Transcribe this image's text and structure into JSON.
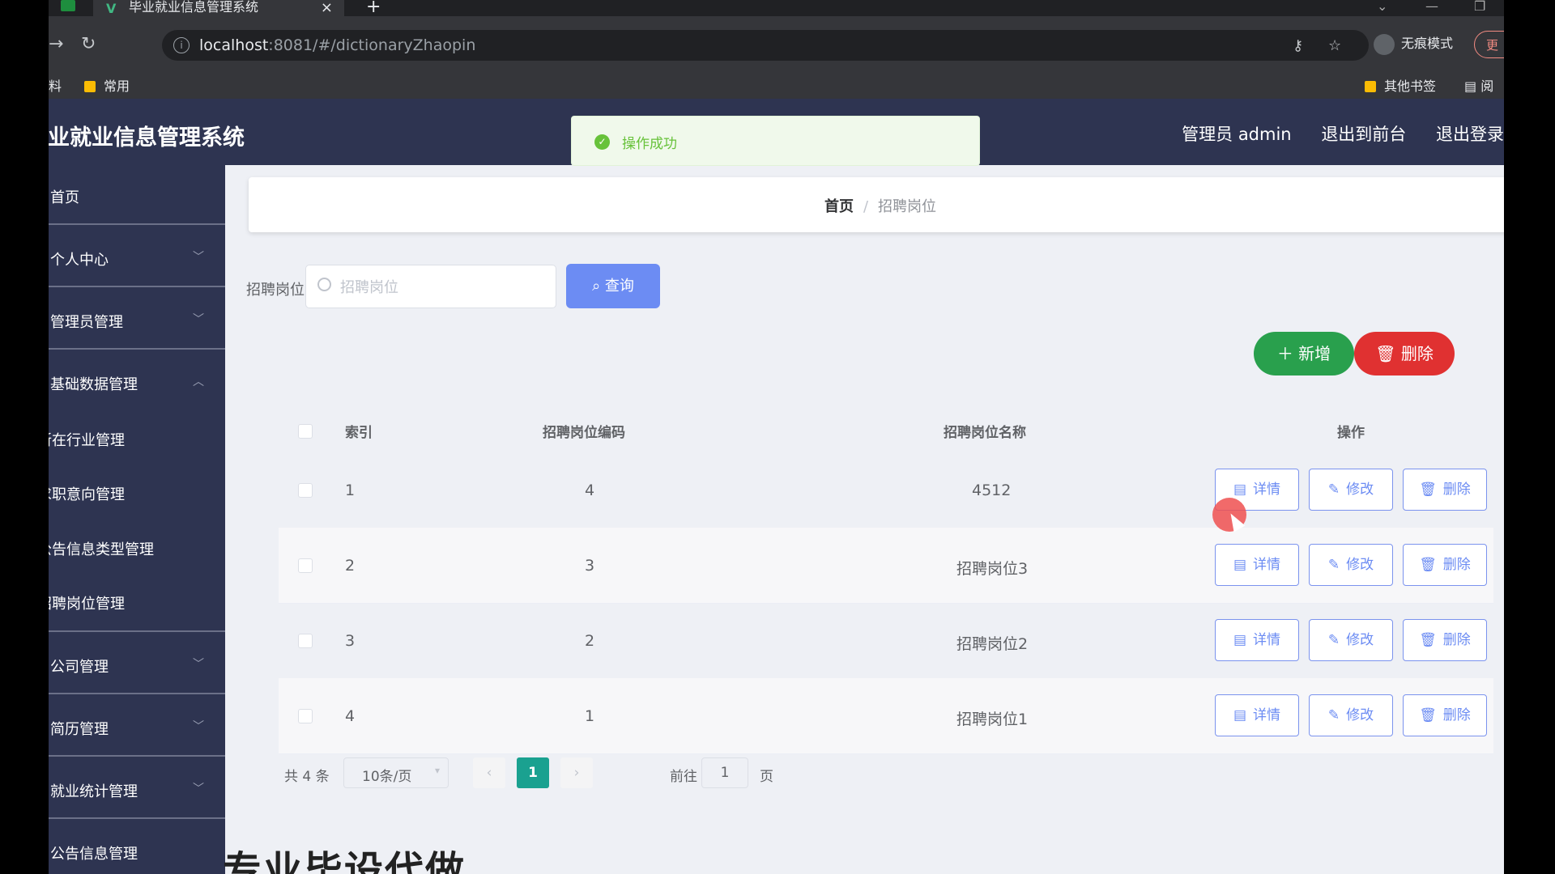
{
  "browser": {
    "tab_title": "毕业就业信息管理系统",
    "url_host": "localhost",
    "url_path": ":8081/#/dictionaryZhaopin",
    "profile_label": "无痕模式",
    "update_label": "更",
    "bookmarks": {
      "left_partial": "料",
      "common": "常用",
      "other": "其他书签",
      "reader": "阅"
    }
  },
  "header": {
    "title": "毕业就业信息管理系统",
    "admin": "管理员 admin",
    "to_front": "退出到前台",
    "logout": "退出登录"
  },
  "toast": {
    "message": "操作成功"
  },
  "sidebar": {
    "items": [
      {
        "label": "首页"
      },
      {
        "label": "个人中心"
      },
      {
        "label": "管理员管理"
      },
      {
        "label": "基础数据管理"
      }
    ],
    "sub_items": [
      {
        "label": "所在行业管理"
      },
      {
        "label": "求职意向管理"
      },
      {
        "label": "公告信息类型管理"
      },
      {
        "label": "招聘岗位管理"
      }
    ],
    "lower_items": [
      {
        "label": "公司管理"
      },
      {
        "label": "简历管理"
      },
      {
        "label": "就业统计管理"
      },
      {
        "label": "公告信息管理"
      }
    ]
  },
  "breadcrumb": {
    "home": "首页",
    "separator": "/",
    "current": "招聘岗位"
  },
  "search": {
    "label": "招聘岗位",
    "placeholder": "招聘岗位",
    "value": "",
    "button": "查询"
  },
  "actions": {
    "add": "新增",
    "delete": "删除"
  },
  "table": {
    "headers": {
      "index": "索引",
      "code": "招聘岗位编码",
      "name": "招聘岗位名称",
      "ops": "操作"
    },
    "rows": [
      {
        "index": "1",
        "code": "4",
        "name": "4512"
      },
      {
        "index": "2",
        "code": "3",
        "name": "招聘岗位3"
      },
      {
        "index": "3",
        "code": "2",
        "name": "招聘岗位2"
      },
      {
        "index": "4",
        "code": "1",
        "name": "招聘岗位1"
      }
    ],
    "row_actions": {
      "detail": "详情",
      "edit": "修改",
      "delete": "删除"
    }
  },
  "pagination": {
    "total": "共 4 条",
    "page_size": "10条/页",
    "current_page": "1",
    "goto_label": "前往",
    "goto_value": "1",
    "page_suffix": "页"
  },
  "watermark": "专业毕设代做",
  "colors": {
    "sidebar": "#2e3451",
    "primary": "#6c8cf3",
    "success": "#29a04d",
    "danger": "#e03131",
    "pager_active": "#1aa190"
  }
}
